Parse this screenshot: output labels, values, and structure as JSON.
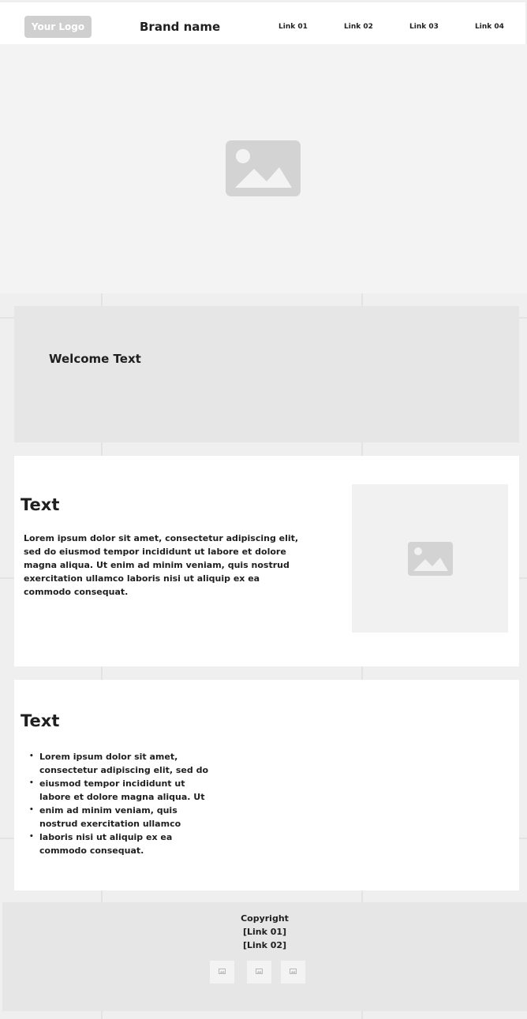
{
  "header": {
    "logo": "Your Logo",
    "brand": "Brand name",
    "links": [
      "Link 01",
      "Link 02",
      "Link 03",
      "Link 04"
    ]
  },
  "hero": {
    "icon": "image-placeholder-icon"
  },
  "welcome": {
    "text": "Welcome Text"
  },
  "section1": {
    "title": "Text",
    "paragraph": "Lorem ipsum dolor sit amet, consectetur adipiscing elit, sed do eiusmod tempor incididunt ut labore et dolore magna aliqua. Ut enim ad minim veniam, quis nostrud exercitation ullamco laboris nisi ut aliquip ex ea commodo consequat.",
    "image_icon": "image-placeholder-icon"
  },
  "section2": {
    "title": "Text",
    "bullets": [
      "Lorem ipsum dolor sit amet, consectetur adipiscing elit, sed do",
      "eiusmod tempor incididunt ut labore et dolore magna aliqua. Ut",
      "enim ad minim veniam, quis nostrud exercitation ullamco",
      "laboris nisi ut aliquip ex ea commodo consequat."
    ]
  },
  "footer": {
    "copyright": "Copyright",
    "link1": "[Link 01]",
    "link2": "[Link 02]",
    "social_icons": [
      "image-icon",
      "image-icon",
      "image-icon"
    ]
  },
  "colors": {
    "page_background": "#efefef",
    "hero_background": "#f3f3f3",
    "panel_gray": "#e6e6e6",
    "placeholder_icon": "#d3d3d3",
    "logo_background": "#cfcfcf"
  }
}
